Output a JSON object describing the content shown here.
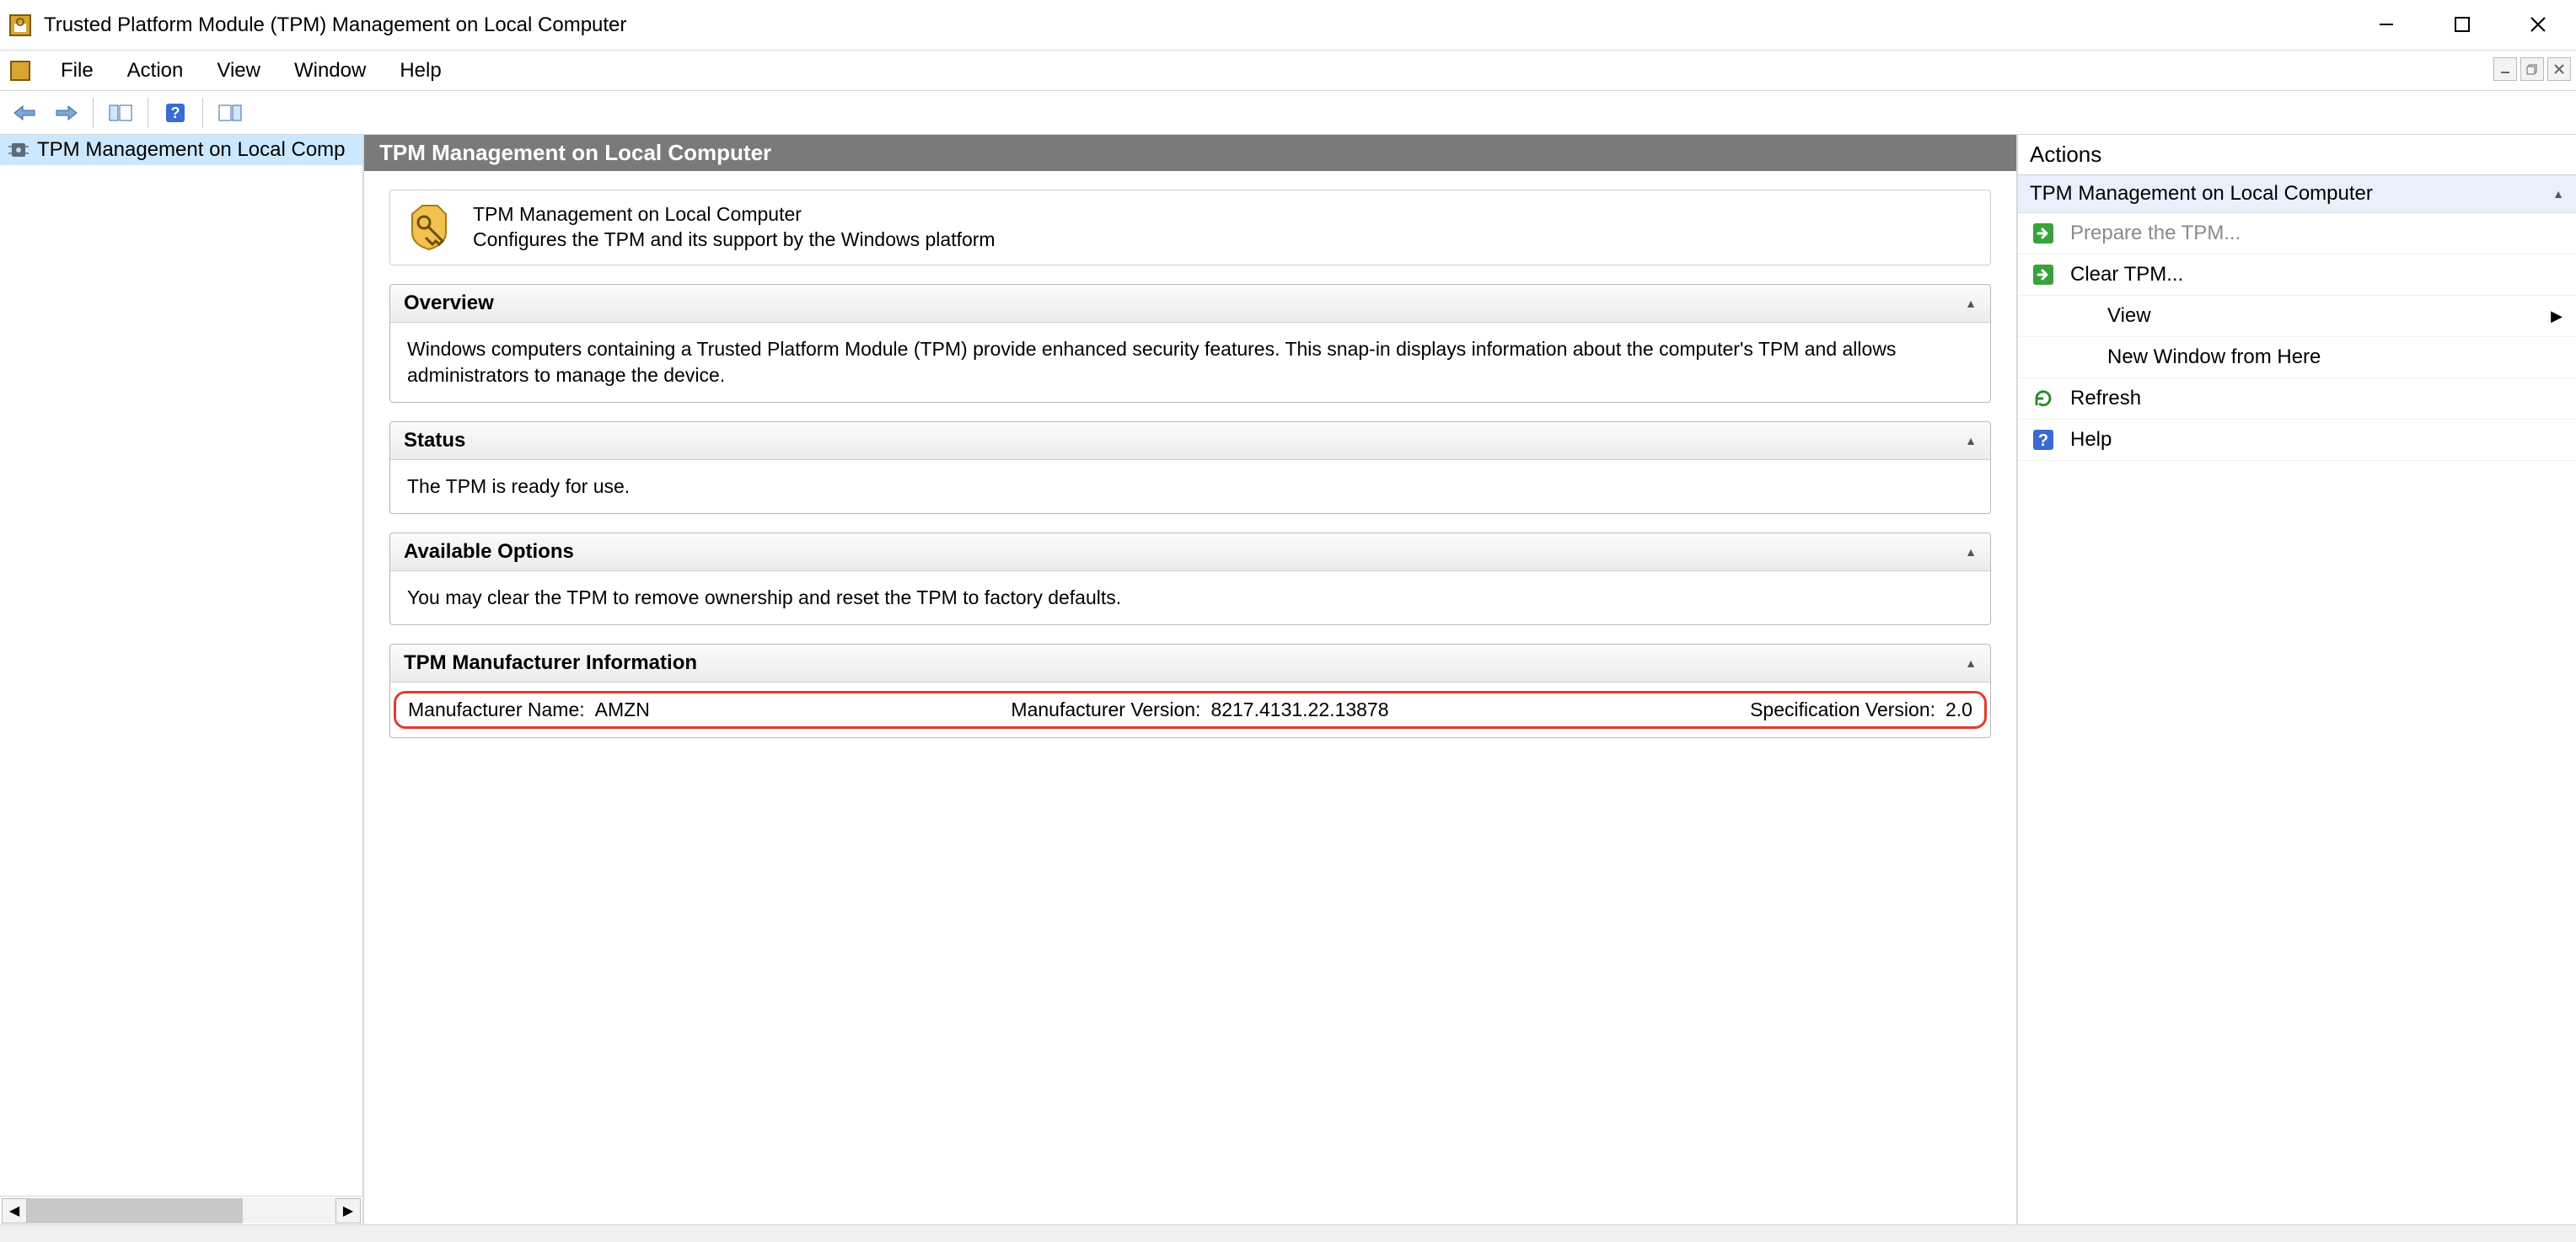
{
  "window": {
    "title": "Trusted Platform Module (TPM) Management on Local Computer"
  },
  "menu": {
    "items": [
      "File",
      "Action",
      "View",
      "Window",
      "Help"
    ]
  },
  "tree": {
    "root": "TPM Management on Local Comp"
  },
  "center": {
    "header": "TPM Management on Local Computer",
    "desc_title": "TPM Management on Local Computer",
    "desc_sub": "Configures the TPM and its support by the Windows platform",
    "overview": {
      "title": "Overview",
      "body": "Windows computers containing a Trusted Platform Module (TPM) provide enhanced security features. This snap-in displays information about the computer's TPM and allows administrators to manage the device."
    },
    "status": {
      "title": "Status",
      "body": "The TPM is ready for use."
    },
    "options": {
      "title": "Available Options",
      "body": "You may clear the TPM to remove ownership and reset the TPM to factory defaults."
    },
    "mfr": {
      "title": "TPM Manufacturer Information",
      "name_label": "Manufacturer Name",
      "name_value": "AMZN",
      "ver_label": "Manufacturer Version",
      "ver_value": "8217.4131.22.13878",
      "spec_label": "Specification Version",
      "spec_value": "2.0"
    }
  },
  "actions": {
    "title": "Actions",
    "subtitle": "TPM Management on Local Computer",
    "items": [
      {
        "label": "Prepare the TPM...",
        "icon": "arrow-green",
        "disabled": true
      },
      {
        "label": "Clear TPM...",
        "icon": "arrow-green",
        "disabled": false
      },
      {
        "label": "View",
        "icon": "",
        "disabled": false,
        "submenu": true,
        "indent": true
      },
      {
        "label": "New Window from Here",
        "icon": "",
        "disabled": false,
        "indent": true
      },
      {
        "label": "Refresh",
        "icon": "refresh",
        "disabled": false
      },
      {
        "label": "Help",
        "icon": "help",
        "disabled": false
      }
    ]
  }
}
